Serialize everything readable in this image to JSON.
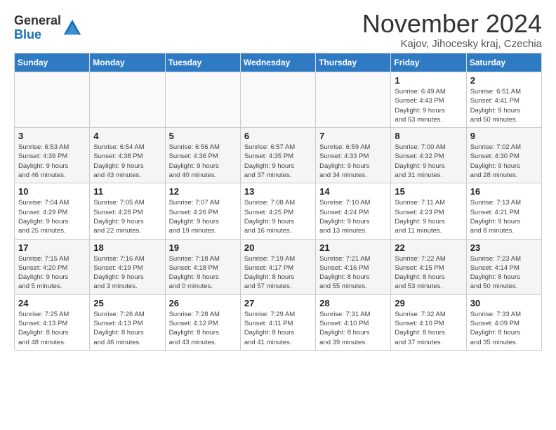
{
  "logo": {
    "general": "General",
    "blue": "Blue"
  },
  "title": "November 2024",
  "location": "Kajov, Jihocesky kraj, Czechia",
  "headers": [
    "Sunday",
    "Monday",
    "Tuesday",
    "Wednesday",
    "Thursday",
    "Friday",
    "Saturday"
  ],
  "weeks": [
    [
      {
        "day": "",
        "info": ""
      },
      {
        "day": "",
        "info": ""
      },
      {
        "day": "",
        "info": ""
      },
      {
        "day": "",
        "info": ""
      },
      {
        "day": "",
        "info": ""
      },
      {
        "day": "1",
        "info": "Sunrise: 6:49 AM\nSunset: 4:43 PM\nDaylight: 9 hours\nand 53 minutes."
      },
      {
        "day": "2",
        "info": "Sunrise: 6:51 AM\nSunset: 4:41 PM\nDaylight: 9 hours\nand 50 minutes."
      }
    ],
    [
      {
        "day": "3",
        "info": "Sunrise: 6:53 AM\nSunset: 4:39 PM\nDaylight: 9 hours\nand 46 minutes."
      },
      {
        "day": "4",
        "info": "Sunrise: 6:54 AM\nSunset: 4:38 PM\nDaylight: 9 hours\nand 43 minutes."
      },
      {
        "day": "5",
        "info": "Sunrise: 6:56 AM\nSunset: 4:36 PM\nDaylight: 9 hours\nand 40 minutes."
      },
      {
        "day": "6",
        "info": "Sunrise: 6:57 AM\nSunset: 4:35 PM\nDaylight: 9 hours\nand 37 minutes."
      },
      {
        "day": "7",
        "info": "Sunrise: 6:59 AM\nSunset: 4:33 PM\nDaylight: 9 hours\nand 34 minutes."
      },
      {
        "day": "8",
        "info": "Sunrise: 7:00 AM\nSunset: 4:32 PM\nDaylight: 9 hours\nand 31 minutes."
      },
      {
        "day": "9",
        "info": "Sunrise: 7:02 AM\nSunset: 4:30 PM\nDaylight: 9 hours\nand 28 minutes."
      }
    ],
    [
      {
        "day": "10",
        "info": "Sunrise: 7:04 AM\nSunset: 4:29 PM\nDaylight: 9 hours\nand 25 minutes."
      },
      {
        "day": "11",
        "info": "Sunrise: 7:05 AM\nSunset: 4:28 PM\nDaylight: 9 hours\nand 22 minutes."
      },
      {
        "day": "12",
        "info": "Sunrise: 7:07 AM\nSunset: 4:26 PM\nDaylight: 9 hours\nand 19 minutes."
      },
      {
        "day": "13",
        "info": "Sunrise: 7:08 AM\nSunset: 4:25 PM\nDaylight: 9 hours\nand 16 minutes."
      },
      {
        "day": "14",
        "info": "Sunrise: 7:10 AM\nSunset: 4:24 PM\nDaylight: 9 hours\nand 13 minutes."
      },
      {
        "day": "15",
        "info": "Sunrise: 7:11 AM\nSunset: 4:23 PM\nDaylight: 9 hours\nand 11 minutes."
      },
      {
        "day": "16",
        "info": "Sunrise: 7:13 AM\nSunset: 4:21 PM\nDaylight: 9 hours\nand 8 minutes."
      }
    ],
    [
      {
        "day": "17",
        "info": "Sunrise: 7:15 AM\nSunset: 4:20 PM\nDaylight: 9 hours\nand 5 minutes."
      },
      {
        "day": "18",
        "info": "Sunrise: 7:16 AM\nSunset: 4:19 PM\nDaylight: 9 hours\nand 3 minutes."
      },
      {
        "day": "19",
        "info": "Sunrise: 7:18 AM\nSunset: 4:18 PM\nDaylight: 9 hours\nand 0 minutes."
      },
      {
        "day": "20",
        "info": "Sunrise: 7:19 AM\nSunset: 4:17 PM\nDaylight: 8 hours\nand 57 minutes."
      },
      {
        "day": "21",
        "info": "Sunrise: 7:21 AM\nSunset: 4:16 PM\nDaylight: 8 hours\nand 55 minutes."
      },
      {
        "day": "22",
        "info": "Sunrise: 7:22 AM\nSunset: 4:15 PM\nDaylight: 8 hours\nand 53 minutes."
      },
      {
        "day": "23",
        "info": "Sunrise: 7:23 AM\nSunset: 4:14 PM\nDaylight: 8 hours\nand 50 minutes."
      }
    ],
    [
      {
        "day": "24",
        "info": "Sunrise: 7:25 AM\nSunset: 4:13 PM\nDaylight: 8 hours\nand 48 minutes."
      },
      {
        "day": "25",
        "info": "Sunrise: 7:26 AM\nSunset: 4:13 PM\nDaylight: 8 hours\nand 46 minutes."
      },
      {
        "day": "26",
        "info": "Sunrise: 7:28 AM\nSunset: 4:12 PM\nDaylight: 8 hours\nand 43 minutes."
      },
      {
        "day": "27",
        "info": "Sunrise: 7:29 AM\nSunset: 4:11 PM\nDaylight: 8 hours\nand 41 minutes."
      },
      {
        "day": "28",
        "info": "Sunrise: 7:31 AM\nSunset: 4:10 PM\nDaylight: 8 hours\nand 39 minutes."
      },
      {
        "day": "29",
        "info": "Sunrise: 7:32 AM\nSunset: 4:10 PM\nDaylight: 8 hours\nand 37 minutes."
      },
      {
        "day": "30",
        "info": "Sunrise: 7:33 AM\nSunset: 4:09 PM\nDaylight: 8 hours\nand 35 minutes."
      }
    ]
  ]
}
